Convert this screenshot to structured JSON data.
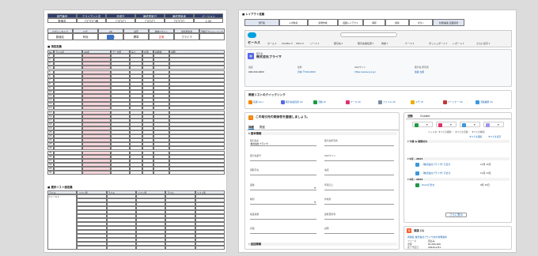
{
  "left": {
    "header_cols": [
      "部門番号",
      "クライアント名",
      "作成日",
      "最終更新日",
      "最終更新者",
      "バージョン"
    ],
    "header_vals": [
      "数値名",
      "〇〇〇〇様",
      "〇/〇/〇",
      "〇/〇/〇",
      "〇〇〇〇",
      "1.00"
    ],
    "sub_cols": [
      "ログインタイプ",
      "ログ",
      "CE",
      "設定",
      "最終ログイン",
      "最新更新者",
      "登録アクションリンク"
    ],
    "sub_vals": [
      "数値名",
      "有効",
      "admin",
      "標準",
      "正常",
      "プライマ"
    ],
    "section1": "■ 項目定義",
    "table_cols": [
      "No.",
      "ラベル名",
      "API名",
      "データ型",
      "長さ",
      "必須",
      "初期値",
      "説明"
    ],
    "row_numbers": [
      "1",
      "2",
      "3",
      "4",
      "5",
      "6",
      "7",
      "8",
      "9",
      "10",
      "11",
      "12",
      "13",
      "14",
      "15",
      "16",
      "17",
      "18",
      "19",
      "20",
      "21",
      "22",
      "23",
      "24",
      "25",
      "26",
      "27",
      "28",
      "29",
      "30"
    ],
    "section2": "■ 選択リスト値定義",
    "pick_cols": [
      "ラベル",
      "リスト値",
      "ラベル",
      "リスト値",
      "ラベル",
      "リスト値"
    ],
    "pick_first": "フィールド"
  },
  "right": {
    "section": "■ レイアウト定義",
    "toolbar": [
      "部門名",
      "1.対象名",
      "新規作成",
      "画面レイアウト",
      "保存",
      "検索",
      "ボタン",
      "新規/編集 画面切替"
    ],
    "app_name": "セールス",
    "nav_tabs": [
      "ホーム",
      "Chatter",
      "ToDo",
      "リード",
      "取引先",
      "取引先責任者",
      "商談",
      "ケース",
      "ダッシュボード",
      "レポート",
      "さらに表示"
    ],
    "record_type": "取引先",
    "record_name": "株式会社プライサ",
    "summary_labels": [
      "電話",
      "住所",
      "Webサイト",
      "取引先 所有者"
    ],
    "summary_vals": [
      "000-000-0000",
      "日本 〒000-0000",
      "https://www.xyz.jp/",
      "佐藤 太郎"
    ],
    "quicklinks_title": "関連リストのクイックリンク",
    "quicklinks": [
      "商談 (0+)",
      "取引先責任者 (0)",
      "活動 (0)",
      "ケース (0)",
      "ファイル (0)",
      "メモ (0)",
      "パートナー (0)",
      "活動履歴 (0)"
    ],
    "alert": "この取引先の関係性を整理しましょう。",
    "tabs": [
      "詳細",
      "関連"
    ],
    "section_header": "基本情報",
    "fields_left": [
      "取引先名",
      "取引先番号",
      "親取引先",
      "業種",
      "種別",
      "従業員数",
      "評価"
    ],
    "fields_right": [
      "取引先所有者",
      "Webサイト",
      "電話",
      "年間売上",
      "作成者",
      "最終更新者",
      "説明"
    ],
    "field_values": [
      "株式会社プライサ",
      "",
      "",
      "",
      "",
      "",
      "",
      ""
    ],
    "footer_section": "追加情報",
    "activity_title": "活動",
    "activity_tabs": [
      "活動",
      "Chatter"
    ],
    "activity_filter": "フィルタ: すべての期間 ・ すべての活動 ・ すべての種別",
    "activity_links": [
      "すべてを展開",
      "すべてを表示"
    ],
    "activity_groups": [
      "今後 & 期限切れ",
      "9月 - 2024",
      "8月 - 2024"
    ],
    "activities": [
      {
        "title": "【株式会社プライサ】打合せ",
        "date": "11月 15日"
      },
      {
        "title": "【株式会社プライサ】打合せ",
        "date": "11月 13日"
      },
      {
        "title": "Zoom打合せ",
        "date": "9月 15日"
      }
    ],
    "more_button": "さらに表示",
    "opps_title": "商談 (1)",
    "opp_name": "商談名 株式会社プライサ向け新規案件",
    "opp_labels": [
      "フェーズ",
      "金額",
      "完了予定日"
    ],
    "opp_vals": [
      "見込み",
      "¥1,000,000",
      "2024/12/31"
    ]
  }
}
